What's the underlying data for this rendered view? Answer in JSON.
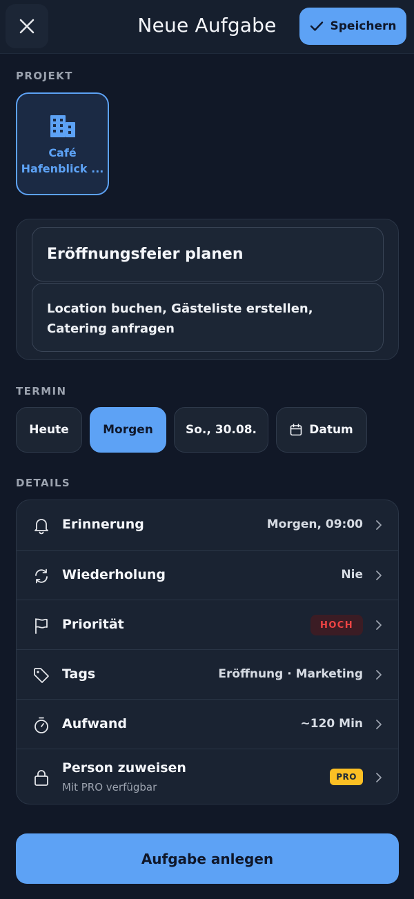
{
  "header": {
    "title": "Neue Aufgabe",
    "save_label": "Speichern",
    "close_icon": "close-icon"
  },
  "project": {
    "section_label": "PROJEKT",
    "name": "Café\nHafenblick ...",
    "icon": "building-icon"
  },
  "task": {
    "title": "Eröffnungsfeier planen",
    "description": "Location buchen, Gästeliste erstellen, Catering anfragen"
  },
  "termin": {
    "section_label": "TERMIN",
    "chips": [
      {
        "label": "Heute",
        "active": false
      },
      {
        "label": "Morgen",
        "active": true
      },
      {
        "label": "So., 30.08.",
        "active": false
      },
      {
        "label": "Datum",
        "active": false,
        "icon": "calendar-icon"
      }
    ]
  },
  "details": {
    "section_label": "DETAILS",
    "rows": [
      {
        "label": "Erinnerung",
        "value": "Morgen, 09:00",
        "icon": "bell-icon"
      },
      {
        "label": "Wiederholung",
        "value": "Nie",
        "icon": "repeat-icon"
      },
      {
        "label": "Priorität",
        "badge": "HOCH",
        "icon": "flag-icon"
      },
      {
        "label": "Tags",
        "value": "Eröffnung · Marketing",
        "icon": "tag-icon"
      },
      {
        "label": "Aufwand",
        "value": "~120 Min",
        "icon": "timer-icon"
      },
      {
        "label": "Person zuweisen",
        "sub": "Mit PRO verfügbar",
        "badge": "PRO",
        "icon": "lock-icon"
      }
    ]
  },
  "footer": {
    "create_label": "Aufgabe anlegen"
  },
  "colors": {
    "background": "#111827",
    "accent": "#5da2f5",
    "priority_high": "#ef4444",
    "pro_badge": "#fbbf24"
  }
}
